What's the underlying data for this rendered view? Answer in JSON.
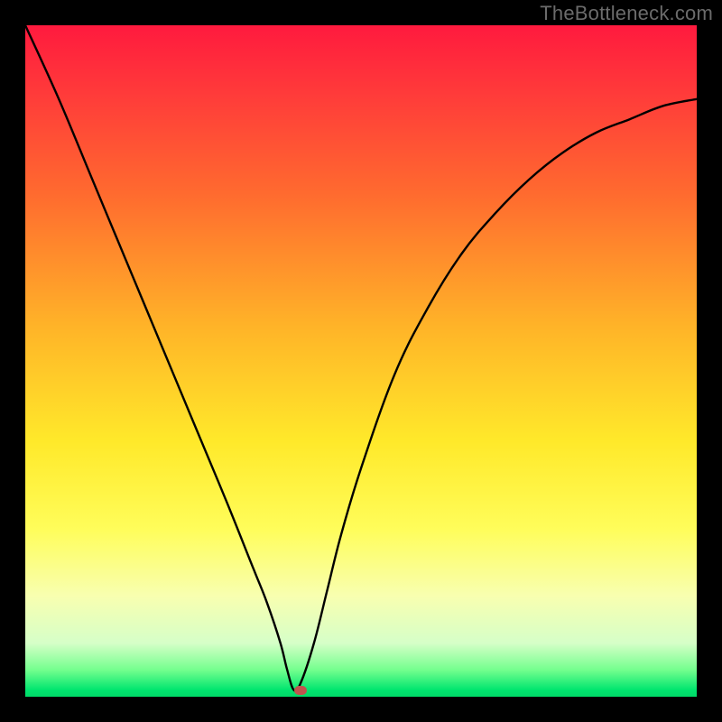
{
  "watermark": "TheBottleneck.com",
  "chart_data": {
    "type": "line",
    "title": "",
    "xlabel": "",
    "ylabel": "",
    "xlim": [
      0,
      100
    ],
    "ylim": [
      0,
      100
    ],
    "grid": false,
    "legend": false,
    "optimum_x": 40,
    "marker": {
      "x": 41,
      "y": 1
    },
    "background_gradient": [
      "#ff1a3e",
      "#ffe92a",
      "#00d968"
    ],
    "series": [
      {
        "name": "bottleneck-curve",
        "x": [
          0,
          5,
          10,
          15,
          20,
          25,
          30,
          34,
          36,
          38,
          39,
          40,
          41,
          43,
          45,
          47,
          50,
          55,
          60,
          65,
          70,
          75,
          80,
          85,
          90,
          95,
          100
        ],
        "values": [
          100,
          89,
          77,
          65,
          53,
          41,
          29,
          19,
          14,
          8,
          4,
          1,
          2,
          8,
          16,
          24,
          34,
          48,
          58,
          66,
          72,
          77,
          81,
          84,
          86,
          88,
          89
        ]
      }
    ]
  }
}
